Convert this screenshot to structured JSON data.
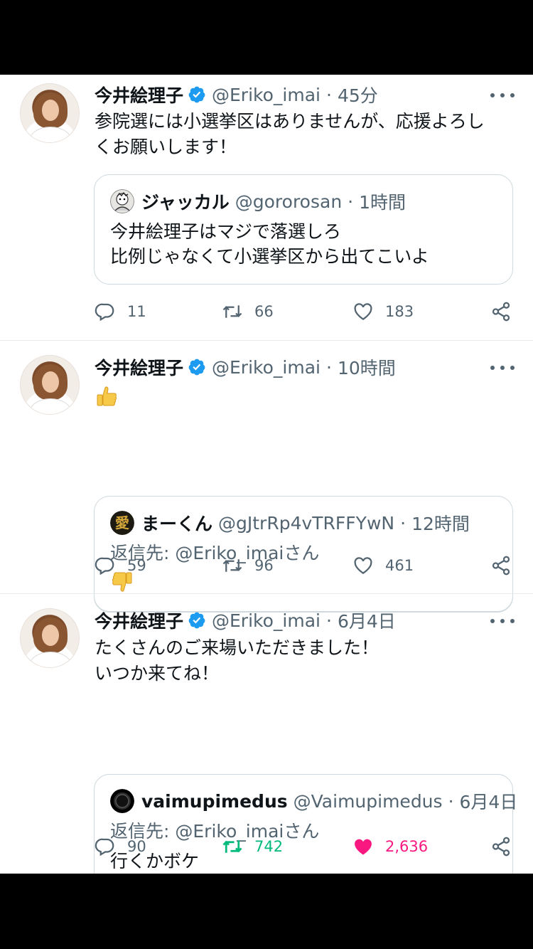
{
  "tweets": [
    {
      "name": "今井絵理子",
      "handle": "@Eriko_imai",
      "separator": "·",
      "time": "45分",
      "text_lines": [
        "参院選には小選挙区はありませんが、応援よろし",
        "くお願いします！"
      ],
      "quote": {
        "name": "ジャッカル",
        "handle": "@gororosan",
        "separator": "·",
        "time": "1時間",
        "lines": [
          "今井絵理子はマジで落選しろ",
          "比例じゃなくて小選挙区から出てこいよ"
        ]
      },
      "counts": {
        "reply": "11",
        "retweet": "66",
        "like": "183"
      },
      "retweeted": false,
      "liked": false
    },
    {
      "name": "今井絵理子",
      "handle": "@Eriko_imai",
      "separator": "·",
      "time": "10時間",
      "emoji": "thumbs-up",
      "quote": {
        "name": "まーくん",
        "handle": "@gJtrRp4vTRFFYwN",
        "separator": "·",
        "time": "12時間",
        "reply_to": "返信先: @Eriko_imaiさん",
        "emoji": "thumbs-down"
      },
      "counts": {
        "reply": "59",
        "retweet": "96",
        "like": "461"
      },
      "retweeted": false,
      "liked": false
    },
    {
      "name": "今井絵理子",
      "handle": "@Eriko_imai",
      "separator": "·",
      "time": "6月4日",
      "text_lines": [
        "たくさんのご来場いただきました！",
        "いつか来てね！"
      ],
      "quote": {
        "name": "vaimupimedus",
        "handle": "@Vaimupimedus",
        "separator": "·",
        "time": "6月4日",
        "reply_to": "返信先: @Eriko_imaiさん",
        "lines": [
          "行くかボケ"
        ]
      },
      "counts": {
        "reply": "90",
        "retweet": "742",
        "like": "2,636"
      },
      "retweeted": true,
      "liked": true
    }
  ],
  "colors": {
    "verified": "#1d9bf0",
    "secondary_text": "#536471",
    "retweet_active": "#00ba7c",
    "like_active": "#f91880"
  }
}
